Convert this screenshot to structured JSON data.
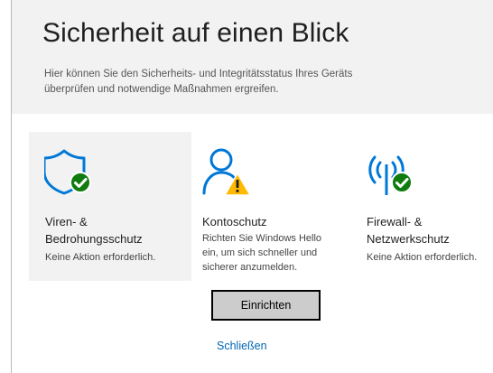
{
  "header": {
    "title": "Sicherheit auf einen Blick",
    "description": "Hier können Sie den Sicherheits- und Integritätsstatus Ihres Geräts überprüfen und notwendige Maßnahmen ergreifen."
  },
  "tiles": [
    {
      "title_line1": "Viren- &",
      "title_line2": "Bedrohungsschutz",
      "status": "Keine Aktion erforderlich.",
      "icon": "shield-check-icon",
      "state": "ok"
    },
    {
      "title_line1": "Kontoschutz",
      "status": "Richten Sie Windows Hello ein, um sich schneller und sicherer anzumelden.",
      "icon": "person-warning-icon",
      "state": "warning",
      "action_label": "Einrichten",
      "dismiss_label": "Schließen"
    },
    {
      "title_line1": "Firewall- &",
      "title_line2": "Netzwerkschutz",
      "status": "Keine Aktion erforderlich.",
      "icon": "wireless-check-icon",
      "state": "ok"
    }
  ],
  "colors": {
    "accent": "#0078d7",
    "ok": "#107c10",
    "warning": "#ffb900",
    "link": "#0066b4"
  }
}
